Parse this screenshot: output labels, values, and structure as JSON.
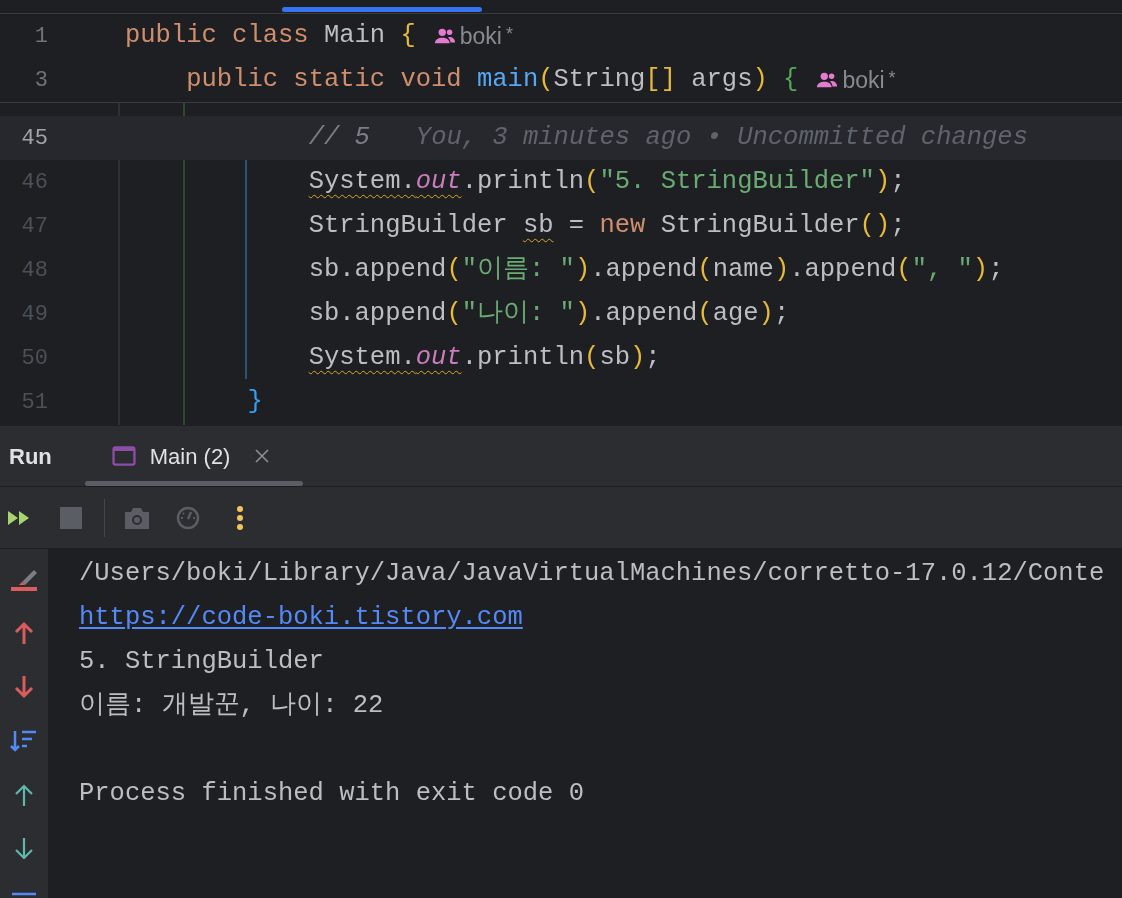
{
  "editor": {
    "sticky_lines": [
      {
        "number": "1",
        "author": "boki",
        "author_mark": "*",
        "tokens": [
          {
            "text": "public class ",
            "kind": "keyword"
          },
          {
            "text": "Main ",
            "kind": "text"
          },
          {
            "text": "{",
            "kind": "bracket_a"
          }
        ]
      },
      {
        "number": "3",
        "author": "boki",
        "author_mark": "*",
        "tokens": [
          {
            "text": "    public static void ",
            "kind": "keyword"
          },
          {
            "text": "main",
            "kind": "method"
          },
          {
            "text": "(",
            "kind": "bracket_a"
          },
          {
            "text": "String",
            "kind": "text"
          },
          {
            "text": "[]",
            "kind": "bracket_a"
          },
          {
            "text": " args",
            "kind": "text"
          },
          {
            "text": ")",
            "kind": "bracket_a"
          },
          {
            "text": " {",
            "kind": "bracket_b"
          }
        ]
      }
    ],
    "lines": [
      {
        "number": "45",
        "current": true,
        "tokens": [
          {
            "text": "            // 5",
            "kind": "comment"
          }
        ],
        "annotation": "You, 3 minutes ago • Uncommitted changes"
      },
      {
        "number": "46",
        "current": false,
        "tokens": [
          {
            "text": "            System.",
            "kind": "text",
            "warning": true
          },
          {
            "text": "out",
            "kind": "field",
            "warning": true
          },
          {
            "text": ".println",
            "kind": "text"
          },
          {
            "text": "(",
            "kind": "bracket_a"
          },
          {
            "text": "\"5. StringBuilder\"",
            "kind": "string"
          },
          {
            "text": ")",
            "kind": "bracket_a"
          },
          {
            "text": ";",
            "kind": "text"
          }
        ]
      },
      {
        "number": "47",
        "current": false,
        "tokens": [
          {
            "text": "            StringBuilder ",
            "kind": "text"
          },
          {
            "text": "sb",
            "kind": "text",
            "warning": true
          },
          {
            "text": " = ",
            "kind": "text"
          },
          {
            "text": "new ",
            "kind": "keyword"
          },
          {
            "text": "StringBuilder",
            "kind": "text"
          },
          {
            "text": "()",
            "kind": "bracket_a"
          },
          {
            "text": ";",
            "kind": "text"
          }
        ]
      },
      {
        "number": "48",
        "current": false,
        "tokens": [
          {
            "text": "            sb.append",
            "kind": "text"
          },
          {
            "text": "(",
            "kind": "bracket_a"
          },
          {
            "text": "\"이름: \"",
            "kind": "string"
          },
          {
            "text": ")",
            "kind": "bracket_a"
          },
          {
            "text": ".append",
            "kind": "text"
          },
          {
            "text": "(",
            "kind": "bracket_a"
          },
          {
            "text": "name",
            "kind": "text"
          },
          {
            "text": ")",
            "kind": "bracket_a"
          },
          {
            "text": ".append",
            "kind": "text"
          },
          {
            "text": "(",
            "kind": "bracket_a"
          },
          {
            "text": "\", \"",
            "kind": "string"
          },
          {
            "text": ")",
            "kind": "bracket_a"
          },
          {
            "text": ";",
            "kind": "text"
          }
        ]
      },
      {
        "number": "49",
        "current": false,
        "tokens": [
          {
            "text": "            sb.append",
            "kind": "text"
          },
          {
            "text": "(",
            "kind": "bracket_a"
          },
          {
            "text": "\"나이: \"",
            "kind": "string"
          },
          {
            "text": ")",
            "kind": "bracket_a"
          },
          {
            "text": ".append",
            "kind": "text"
          },
          {
            "text": "(",
            "kind": "bracket_a"
          },
          {
            "text": "age",
            "kind": "text"
          },
          {
            "text": ")",
            "kind": "bracket_a"
          },
          {
            "text": ";",
            "kind": "text"
          }
        ]
      },
      {
        "number": "50",
        "current": false,
        "tokens": [
          {
            "text": "            System.",
            "kind": "text",
            "warning": true
          },
          {
            "text": "out",
            "kind": "field",
            "warning": true
          },
          {
            "text": ".println",
            "kind": "text"
          },
          {
            "text": "(",
            "kind": "bracket_a"
          },
          {
            "text": "sb",
            "kind": "text"
          },
          {
            "text": ")",
            "kind": "bracket_a"
          },
          {
            "text": ";",
            "kind": "text"
          }
        ]
      },
      {
        "number": "51",
        "current": false,
        "tokens": [
          {
            "text": "        }",
            "kind": "bracket_c"
          }
        ]
      }
    ]
  },
  "run_panel": {
    "title": "Run",
    "tabs": [
      {
        "label": "Main (2)",
        "selected": true
      }
    ],
    "console": [
      {
        "text": "/Users/boki/Library/Java/JavaVirtualMachines/corretto-17.0.12/Conte",
        "kind": "command"
      },
      {
        "text": "https://code-boki.tistory.com",
        "kind": "link"
      },
      {
        "text": "5. StringBuilder",
        "kind": "output"
      },
      {
        "text": "이름: 개발꾼, 나이: 22",
        "kind": "output"
      },
      {
        "text": "Process finished with exit code 0",
        "kind": "exit"
      }
    ]
  }
}
